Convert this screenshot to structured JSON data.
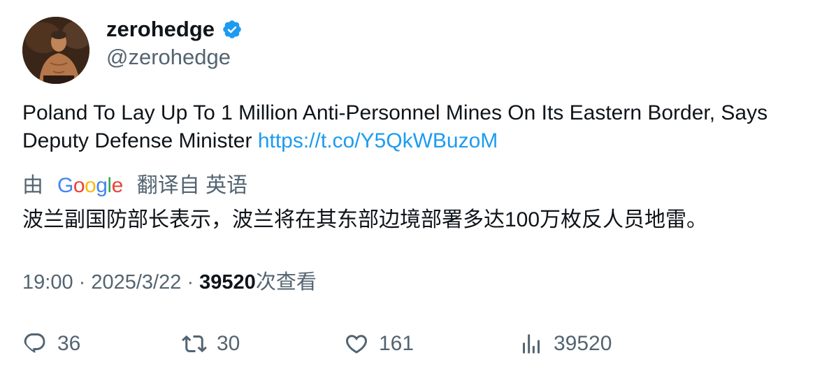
{
  "author": {
    "display_name": "zerohedge",
    "handle": "@zerohedge",
    "verified": true,
    "verified_icon": "verified-badge-icon",
    "verified_color": "#1d9bf0"
  },
  "tweet": {
    "text": "Poland To Lay Up To 1 Million Anti-Personnel Mines On Its Eastern Border, Says Deputy Defense Minister",
    "link_text": "https://t.co/Y5QkWBuzoM",
    "link_color": "#1d9bf0"
  },
  "translation": {
    "prefix": "由",
    "provider": "Google",
    "suffix": "翻译自 英语",
    "text": "波兰副国防部长表示，波兰将在其东部边境部署多达100万枚反人员地雷。"
  },
  "meta": {
    "time": "19:00",
    "separator": "·",
    "date": "2025/3/22",
    "views_count": "39520",
    "views_label": "次查看"
  },
  "actions": {
    "reply": {
      "icon": "reply-icon",
      "count": "36"
    },
    "retweet": {
      "icon": "retweet-icon",
      "count": "30"
    },
    "like": {
      "icon": "heart-icon",
      "count": "161"
    },
    "views": {
      "icon": "analytics-icon",
      "count": "39520"
    }
  },
  "colors": {
    "text_primary": "#0f1419",
    "text_secondary": "#536471",
    "google_blue": "#4285f4",
    "google_red": "#ea4335",
    "google_yellow": "#fbbc05",
    "google_green": "#34a853"
  }
}
